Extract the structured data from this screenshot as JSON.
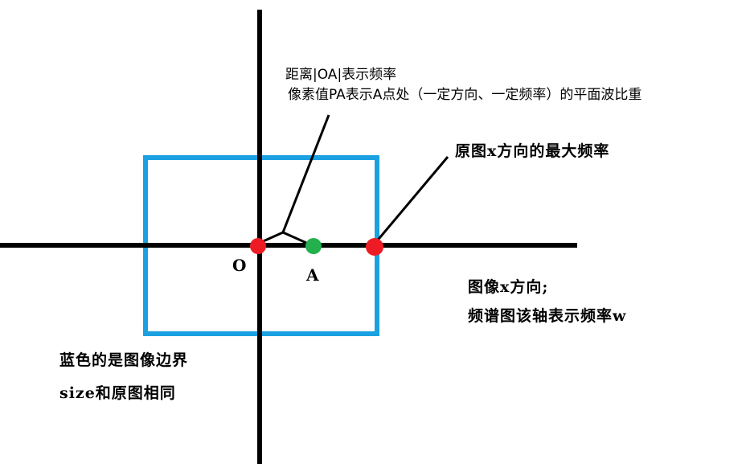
{
  "annotations": {
    "distance_line1": "距离|OA|表示频率",
    "distance_line2": "像素值PA表示A点处（一定方向、一定频率）的平面波比重",
    "max_freq": "原图x方向的最大频率",
    "x_dir_line1": "图像x方向;",
    "x_dir_line2": "频谱图该轴表示频率w",
    "blue_line1": "蓝色的是图像边界",
    "blue_line2": "size和原图相同"
  },
  "points": {
    "origin": "O",
    "a": "A"
  },
  "colors": {
    "axis": "#000000",
    "boundary": "#1ba1e2",
    "red_point": "#ed1c24",
    "green_point": "#22b14c"
  }
}
